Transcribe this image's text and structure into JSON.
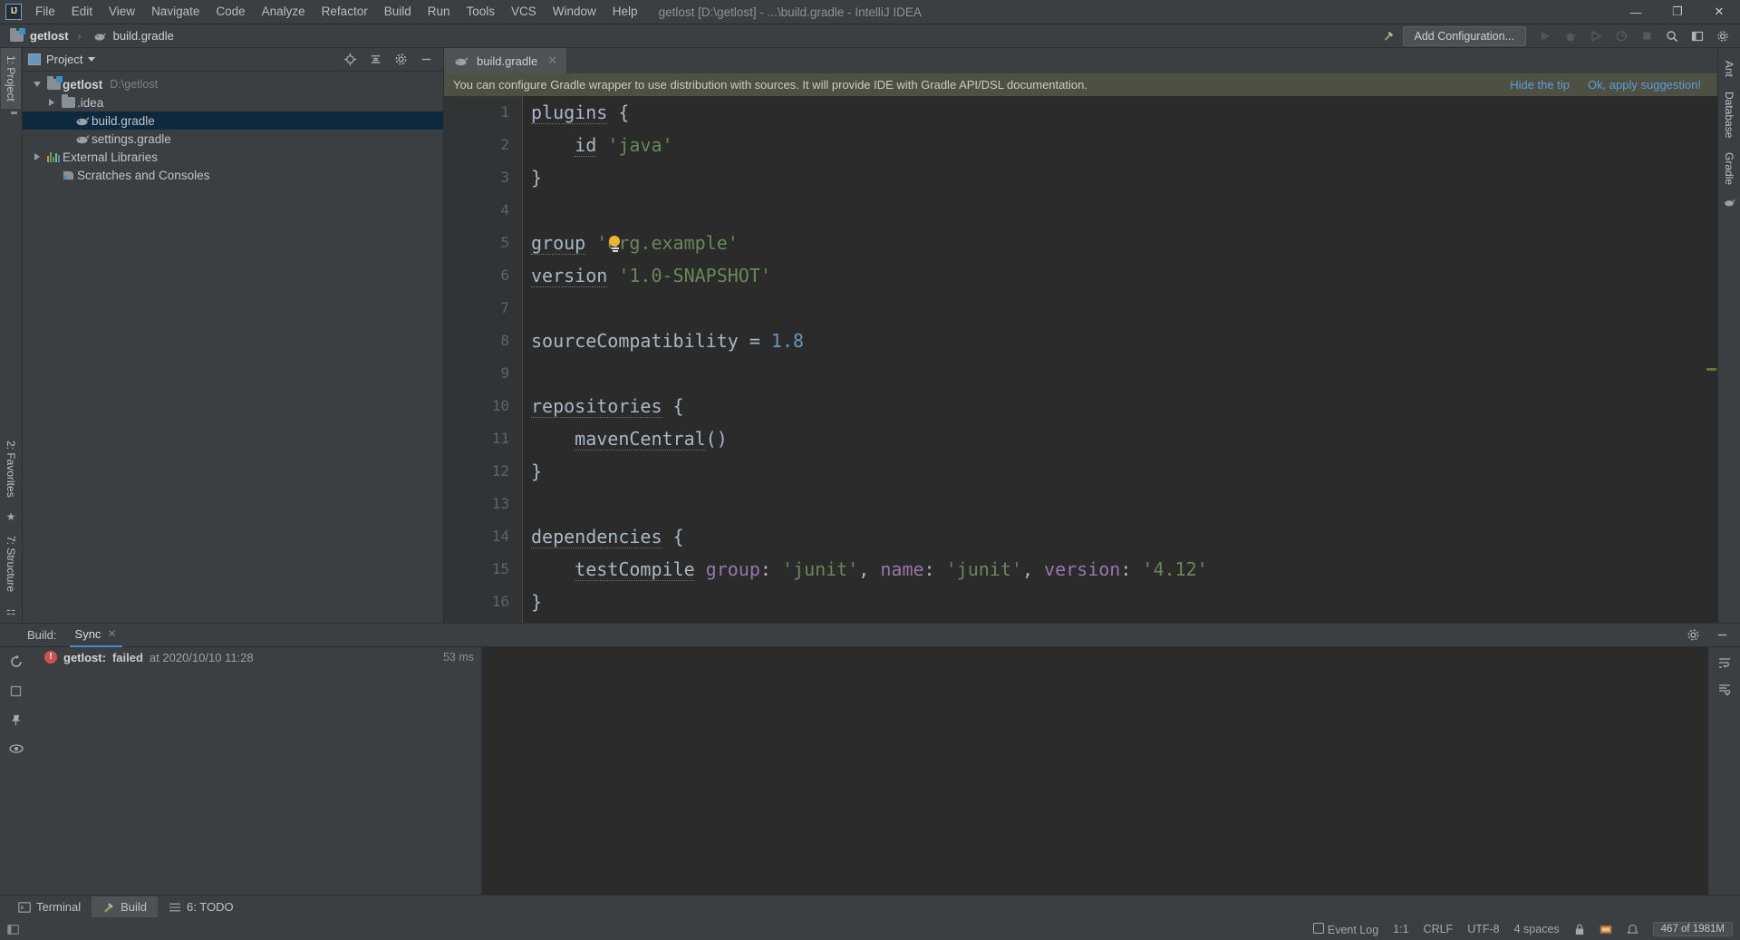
{
  "window": {
    "title": "getlost [D:\\getlost] - ...\\build.gradle - IntelliJ IDEA",
    "logo": "IJ",
    "minimize": "—",
    "maximize": "❐",
    "close": "✕"
  },
  "menu": [
    {
      "label": "File"
    },
    {
      "label": "Edit"
    },
    {
      "label": "View"
    },
    {
      "label": "Navigate"
    },
    {
      "label": "Code"
    },
    {
      "label": "Analyze"
    },
    {
      "label": "Refactor"
    },
    {
      "label": "Build"
    },
    {
      "label": "Run"
    },
    {
      "label": "Tools"
    },
    {
      "label": "VCS"
    },
    {
      "label": "Window"
    },
    {
      "label": "Help"
    }
  ],
  "navbar": {
    "crumb_project": "getlost",
    "separator": "›",
    "crumb_file": "build.gradle",
    "add_configuration": "Add Configuration...",
    "icons": [
      "hammer-icon",
      "run-icon",
      "debug-icon",
      "run-coverage-icon",
      "profile-icon",
      "stop-icon",
      "search-everywhere-icon",
      "layout-icon",
      "settings-icon"
    ]
  },
  "left_stripe": {
    "project_tab": "1: Project",
    "structure_tab": "7: Structure",
    "favorites_tab": "2: Favorites"
  },
  "right_stripe": {
    "ant_tab": "Ant",
    "database_tab": "Database",
    "gradle_tab": "Gradle"
  },
  "project_panel": {
    "title": "Project",
    "header_icons": [
      "locate-icon",
      "collapse-all-icon",
      "settings-icon",
      "hide-icon"
    ],
    "tree": [
      {
        "label": "getlost",
        "path": "D:\\getlost",
        "icon": "project-folder-icon",
        "indent": 0,
        "arrow": "down",
        "bold": true,
        "selected": false
      },
      {
        "label": ".idea",
        "path": "",
        "icon": "folder-icon",
        "indent": 1,
        "arrow": "right",
        "bold": false,
        "selected": false
      },
      {
        "label": "build.gradle",
        "path": "",
        "icon": "gradle-file-icon",
        "indent": 2,
        "arrow": "none",
        "bold": false,
        "selected": true
      },
      {
        "label": "settings.gradle",
        "path": "",
        "icon": "gradle-file-icon",
        "indent": 2,
        "arrow": "none",
        "bold": false,
        "selected": false
      },
      {
        "label": "External Libraries",
        "path": "",
        "icon": "libraries-icon",
        "indent": 0,
        "arrow": "right",
        "bold": false,
        "selected": false
      },
      {
        "label": "Scratches and Consoles",
        "path": "",
        "icon": "scratches-icon",
        "indent": 0,
        "arrow": "none",
        "bold": false,
        "selected": false
      }
    ]
  },
  "editor": {
    "tabs": [
      {
        "label": "build.gradle",
        "icon": "gradle-file-icon",
        "close": "✕",
        "active": true
      }
    ],
    "tip": {
      "message": "You can configure Gradle wrapper to use distribution with sources. It will provide IDE with Gradle API/DSL documentation.",
      "hide_link": "Hide the tip",
      "apply_link": "Ok, apply suggestion!"
    },
    "line_numbers": [
      "1",
      "2",
      "3",
      "4",
      "5",
      "6",
      "7",
      "8",
      "9",
      "10",
      "11",
      "12",
      "13",
      "14",
      "15",
      "16"
    ],
    "lines": [
      {
        "n": 1,
        "fold": "minus-open",
        "tokens": [
          {
            "t": "plugins",
            "c": "fn"
          },
          {
            "t": " ",
            "c": "plain"
          },
          {
            "t": "{",
            "c": "brace"
          }
        ]
      },
      {
        "n": 2,
        "fold": "",
        "bulb": true,
        "tokens": [
          {
            "t": "    ",
            "c": "plain"
          },
          {
            "t": "id",
            "c": "fn"
          },
          {
            "t": " ",
            "c": "plain"
          },
          {
            "t": "'java'",
            "c": "str"
          }
        ]
      },
      {
        "n": 3,
        "fold": "minus-close",
        "tokens": [
          {
            "t": "}",
            "c": "brace"
          }
        ]
      },
      {
        "n": 4,
        "fold": "",
        "tokens": []
      },
      {
        "n": 5,
        "fold": "",
        "tokens": [
          {
            "t": "group",
            "c": "fn"
          },
          {
            "t": " ",
            "c": "plain"
          },
          {
            "t": "'org.example'",
            "c": "str"
          }
        ]
      },
      {
        "n": 6,
        "fold": "",
        "tokens": [
          {
            "t": "version",
            "c": "fn"
          },
          {
            "t": " ",
            "c": "plain"
          },
          {
            "t": "'1.0-SNAPSHOT'",
            "c": "str"
          }
        ]
      },
      {
        "n": 7,
        "fold": "",
        "tokens": []
      },
      {
        "n": 8,
        "fold": "",
        "tokens": [
          {
            "t": "sourceCompatibility",
            "c": "plain"
          },
          {
            "t": " = ",
            "c": "plain"
          },
          {
            "t": "1.8",
            "c": "num"
          }
        ]
      },
      {
        "n": 9,
        "fold": "",
        "tokens": []
      },
      {
        "n": 10,
        "fold": "minus-open",
        "tokens": [
          {
            "t": "repositories",
            "c": "fn"
          },
          {
            "t": " ",
            "c": "plain"
          },
          {
            "t": "{",
            "c": "brace"
          }
        ]
      },
      {
        "n": 11,
        "fold": "",
        "tokens": [
          {
            "t": "    ",
            "c": "plain"
          },
          {
            "t": "mavenCentral",
            "c": "fn"
          },
          {
            "t": "()",
            "c": "plain"
          }
        ]
      },
      {
        "n": 12,
        "fold": "minus-close",
        "tokens": [
          {
            "t": "}",
            "c": "brace"
          }
        ]
      },
      {
        "n": 13,
        "fold": "",
        "tokens": []
      },
      {
        "n": 14,
        "fold": "minus-open",
        "tokens": [
          {
            "t": "dependencies",
            "c": "fn"
          },
          {
            "t": " ",
            "c": "plain"
          },
          {
            "t": "{",
            "c": "brace"
          }
        ]
      },
      {
        "n": 15,
        "fold": "",
        "tokens": [
          {
            "t": "    ",
            "c": "plain"
          },
          {
            "t": "testCompile",
            "c": "fn"
          },
          {
            "t": " ",
            "c": "plain"
          },
          {
            "t": "group",
            "c": "prop"
          },
          {
            "t": ": ",
            "c": "plain"
          },
          {
            "t": "'junit'",
            "c": "str"
          },
          {
            "t": ", ",
            "c": "plain"
          },
          {
            "t": "name",
            "c": "prop"
          },
          {
            "t": ": ",
            "c": "plain"
          },
          {
            "t": "'junit'",
            "c": "str"
          },
          {
            "t": ", ",
            "c": "plain"
          },
          {
            "t": "version",
            "c": "prop"
          },
          {
            "t": ": ",
            "c": "plain"
          },
          {
            "t": "'4.12'",
            "c": "str"
          }
        ]
      },
      {
        "n": 16,
        "fold": "minus-close",
        "tokens": [
          {
            "t": "}",
            "c": "brace"
          }
        ]
      }
    ]
  },
  "build_panel": {
    "label": "Build:",
    "tab": "Sync",
    "tab_close": "✕",
    "row": {
      "project": "getlost:",
      "status": "failed",
      "at": "at 2020/10/10 11:28",
      "duration": "53 ms"
    },
    "side_icons": [
      "rerun-icon",
      "stop-icon",
      "pin-icon",
      "eye-icon"
    ],
    "header_icons": [
      "settings-icon",
      "hide-icon"
    ],
    "right_icons": [
      "soft-wrap-icon",
      "scroll-end-icon"
    ]
  },
  "bottom_bar": [
    {
      "label": "Terminal",
      "icon": "terminal-icon",
      "active": false
    },
    {
      "label": "Build",
      "icon": "build-icon",
      "active": true
    },
    {
      "label": "6: TODO",
      "icon": "todo-icon",
      "active": false
    }
  ],
  "status_bar": {
    "event_log": "Event Log",
    "position": "1:1",
    "line_sep": "CRLF",
    "encoding": "UTF-8",
    "indent": "4 spaces",
    "lock": "lock-icon",
    "memory": "467 of 1981M"
  },
  "colors": {
    "accent_blue": "#4a88c7",
    "link_blue": "#5c9fd6",
    "selection": "#0d293e",
    "tip_bg": "#4e5044",
    "error_red": "#d05050",
    "string_green": "#6a8759",
    "number_blue": "#6897bb",
    "panel_bg": "#3c3f41",
    "editor_bg": "#2b2b2b",
    "gutter_bg": "#313335"
  }
}
